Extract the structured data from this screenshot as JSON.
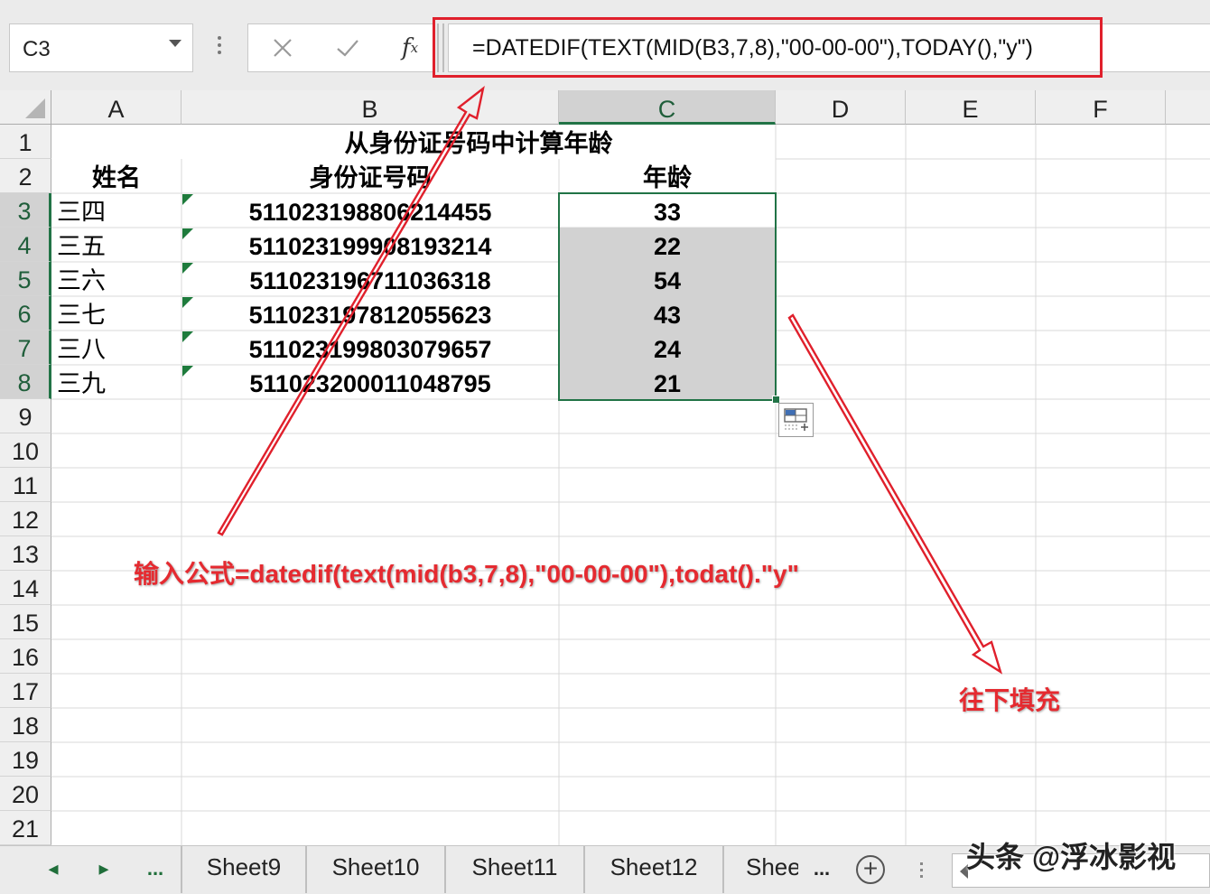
{
  "formula_bar": {
    "name_box": "C3",
    "formula": "=DATEDIF(TEXT(MID(B3,7,8),\"00-00-00\"),TODAY(),\"y\")",
    "fx_label": "f",
    "fx_sub": "x"
  },
  "columns": [
    "A",
    "B",
    "C",
    "D",
    "E",
    "F"
  ],
  "rows": [
    "1",
    "2",
    "3",
    "4",
    "5",
    "6",
    "7",
    "8",
    "9",
    "10",
    "11",
    "12",
    "13",
    "14",
    "15",
    "16",
    "17",
    "18",
    "19",
    "20",
    "21"
  ],
  "sheet": {
    "title": "从身份证号码中计算年龄",
    "headers": {
      "name": "姓名",
      "id": "身份证号码",
      "age": "年龄"
    },
    "records": [
      {
        "name": "三四",
        "id": "511023198806214455",
        "age": "33"
      },
      {
        "name": "三五",
        "id": "511023199908193214",
        "age": "22"
      },
      {
        "name": "三六",
        "id": "511023196711036318",
        "age": "54"
      },
      {
        "name": "三七",
        "id": "511023197812055623",
        "age": "43"
      },
      {
        "name": "三八",
        "id": "511023199803079657",
        "age": "24"
      },
      {
        "name": "三九",
        "id": "511023200011048795",
        "age": "21"
      }
    ]
  },
  "tabs": {
    "nav_prev": "◂",
    "nav_next": "▸",
    "nav_more": "...",
    "items": [
      "Sheet9",
      "Sheet10",
      "Sheet11",
      "Sheet12",
      "Shee"
    ],
    "more_after": "...",
    "add": "+"
  },
  "annotations": {
    "formula_note": "输入公式=datedif(text(mid(b3,7,8),\"00-00-00\"),todat().\"y\"",
    "fill_note": "往下填充",
    "watermark": "头条 @浮冰影视"
  },
  "colors": {
    "annotation_red": "#e52a30",
    "selection_green": "#217346",
    "selected_fill": "#d2d2d2"
  }
}
